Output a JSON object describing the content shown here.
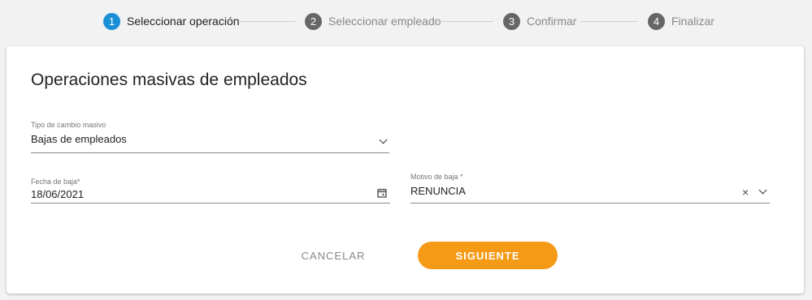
{
  "stepper": {
    "steps": [
      {
        "number": "1",
        "label": "Seleccionar operación",
        "active": true
      },
      {
        "number": "2",
        "label": "Seleccionar empleado",
        "active": false
      },
      {
        "number": "3",
        "label": "Confirmar",
        "active": false
      },
      {
        "number": "4",
        "label": "Finalizar",
        "active": false
      }
    ]
  },
  "card": {
    "title": "Operaciones masivas de empleados",
    "tipo_cambio": {
      "label": "Tipo de cambio masivo",
      "value": "Bajas de empleados"
    },
    "fecha_baja": {
      "label": "Fecha de baja*",
      "value": "18/06/2021"
    },
    "motivo_baja": {
      "label": "Motivo de baja *",
      "value": "RENUNCIA",
      "clear_symbol": "×"
    },
    "cancel_label": "CANCELAR",
    "next_label": "SIGUIENTE"
  },
  "colors": {
    "accent": "#f59a16",
    "active_step": "#1a8fd6",
    "inactive_step": "#666666"
  },
  "icons": {
    "calendar": "calendar-icon",
    "chevron": "chevron-down-icon",
    "clear": "close-icon"
  }
}
